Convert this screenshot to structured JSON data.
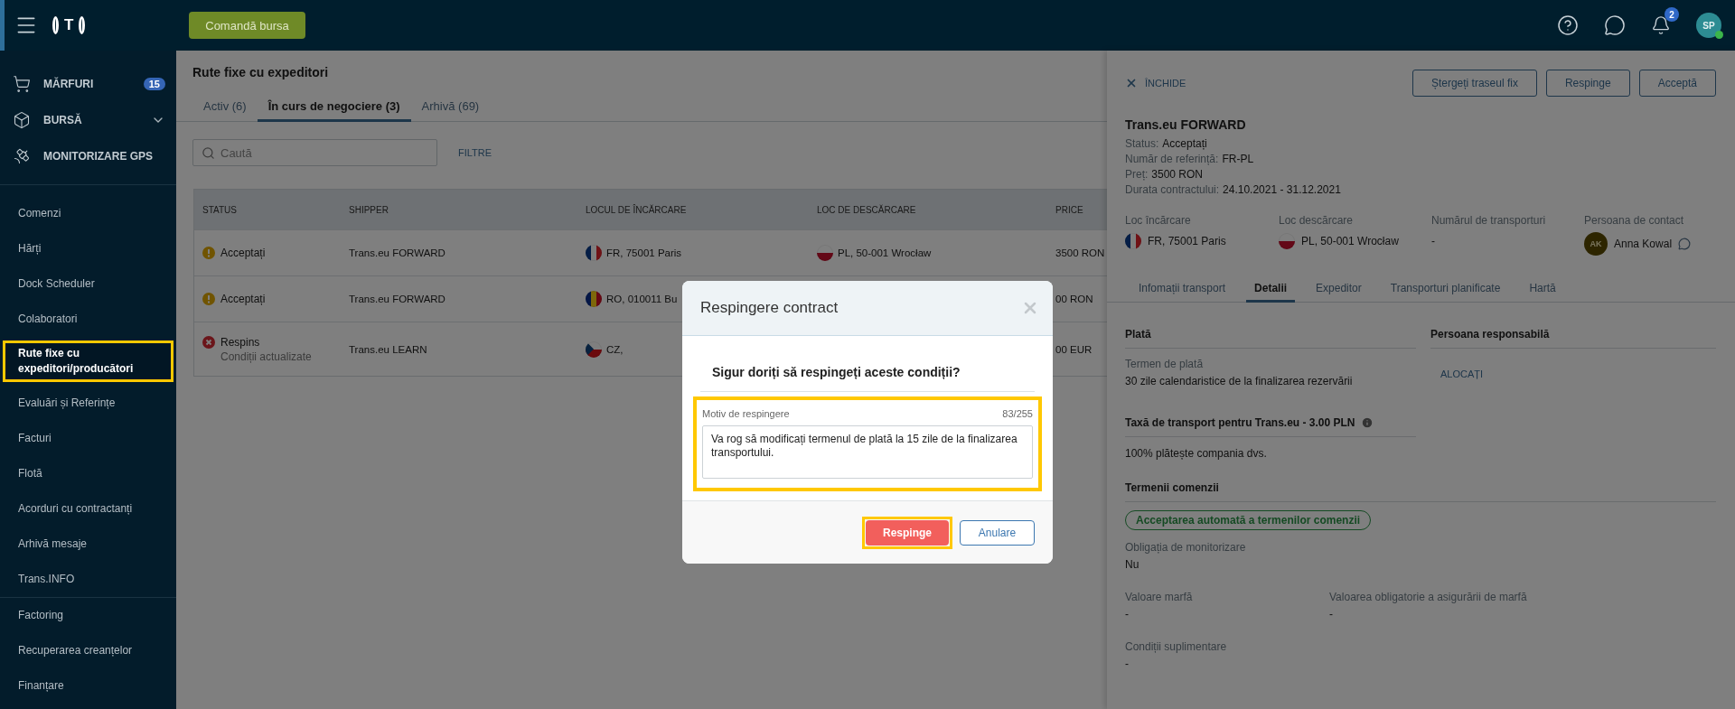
{
  "topbar": {
    "logo": "T",
    "order_button": "Comandă bursa",
    "notifications_badge": "2",
    "avatar": "SP",
    "online": true
  },
  "sidebar": {
    "main_items": [
      {
        "kind": "cart",
        "label": "MĂRFURI",
        "badge": "15"
      },
      {
        "kind": "box",
        "label": "BURSĂ",
        "expanded": false
      },
      {
        "kind": "satellite",
        "label": "MONITORIZARE GPS"
      }
    ],
    "sections": [
      [
        {
          "label": "Comenzi",
          "selected": false,
          "highlighted": false
        },
        {
          "label": "Hărți",
          "selected": false,
          "highlighted": false
        },
        {
          "label": "Dock Scheduler",
          "selected": false,
          "highlighted": false
        },
        {
          "label": "Colaboratori",
          "selected": false,
          "highlighted": false
        },
        {
          "label": "Rute fixe cu expeditori/producători",
          "selected": true,
          "highlighted": true
        },
        {
          "label": "Evaluări și Referințe",
          "selected": false,
          "highlighted": false
        },
        {
          "label": "Facturi",
          "selected": false,
          "highlighted": false
        },
        {
          "label": "Flotă",
          "selected": false,
          "highlighted": false
        },
        {
          "label": "Acorduri cu contractanți",
          "selected": false,
          "highlighted": false
        },
        {
          "label": "Arhivă mesaje",
          "selected": false,
          "highlighted": false
        },
        {
          "label": "Trans.INFO",
          "selected": false,
          "highlighted": false
        }
      ],
      [
        {
          "label": "Factoring",
          "selected": false,
          "highlighted": false
        },
        {
          "label": "Recuperarea creanțelor",
          "selected": false,
          "highlighted": false
        },
        {
          "label": "Finanțare",
          "selected": false,
          "highlighted": false
        }
      ]
    ]
  },
  "page": {
    "title": "Rute fixe cu expeditori",
    "tabs": [
      {
        "label": "Activ (6)",
        "selected": false
      },
      {
        "label": "În curs de negociere (3)",
        "selected": true
      },
      {
        "label": "Arhivă (69)",
        "selected": false
      }
    ],
    "search": {
      "placeholder": "Caută"
    },
    "filters": "FILTRE",
    "table": {
      "columns": [
        "STATUS",
        "SHIPPER",
        "LOCUL DE ÎNCĂRCARE",
        "LOC DE DESCĂRCARE",
        "PRICE"
      ],
      "rows": [
        {
          "status": {
            "kind": "warning",
            "label": "Acceptați"
          },
          "shipper": "Trans.eu FORWARD",
          "loading": {
            "flag": {
              "kind": "fr"
            },
            "text": "FR, 75001 Paris"
          },
          "unloading": {
            "flag": {
              "kind": "pl"
            },
            "text": "PL, 50-001 Wrocław"
          },
          "price": "3500 RON"
        },
        {
          "status": {
            "kind": "warning",
            "label": "Acceptați"
          },
          "shipper": "Trans.eu FORWARD",
          "loading": {
            "flag": {
              "kind": "ro"
            },
            "text": "RO, 010011 Bu"
          },
          "price": "00 RON"
        },
        {
          "status": {
            "kind": "error",
            "label": "Respins",
            "note": "Condiții actualizate"
          },
          "shipper": "Trans.eu LEARN",
          "loading": {
            "flag": {
              "kind": "cz"
            },
            "text": "CZ,"
          },
          "price": "00 EUR"
        }
      ]
    }
  },
  "panel": {
    "close": "ÎNCHIDE",
    "actions": [
      "Ștergeți traseul fix",
      "Respinge",
      "Acceptă"
    ],
    "title": "Trans.eu FORWARD",
    "facts": [
      {
        "label": "Status:",
        "value": "Acceptați"
      },
      {
        "label": "Număr de referință:",
        "value": "FR-PL"
      },
      {
        "label": "Preț:",
        "value": "3500 RON"
      },
      {
        "label": "Durata contractului:",
        "value": "24.10.2021 - 31.12.2021"
      }
    ],
    "route": [
      {
        "kind": "place",
        "label": "Loc încărcare",
        "flag": {
          "kind": "fr"
        },
        "value": "FR, 75001 Paris"
      },
      {
        "kind": "place",
        "label": "Loc descărcare",
        "flag": {
          "kind": "pl"
        },
        "value": "PL, 50-001 Wrocław"
      },
      {
        "kind": "text",
        "label": "Numărul de transporturi",
        "value": "-"
      },
      {
        "kind": "contact",
        "label": "Persoana de contact",
        "initials": "AK",
        "value": "Anna Kowal"
      }
    ],
    "tabs": [
      {
        "label": "Infomații transport",
        "selected": false
      },
      {
        "label": "Detalii",
        "selected": true
      },
      {
        "label": "Expeditor",
        "selected": false
      },
      {
        "label": "Transporturi planificate",
        "selected": false
      },
      {
        "label": "Hartă",
        "selected": false
      }
    ],
    "payment": {
      "heading": "Plată",
      "term_label": "Termen de plată",
      "term_value": "30 zile calendaristice de la finalizarea rezervării"
    },
    "responsible": {
      "heading": "Persoana responsabilă",
      "action": "ALOCAȚI"
    },
    "fee": {
      "heading": "Taxă de transport pentru Trans.eu - 3.00 PLN",
      "value": "100% plătește compania dvs."
    },
    "terms": {
      "heading": "Termenii comenzii",
      "badge": "Acceptarea automată a termenilor comenzii",
      "fields": [
        [
          {
            "label": "Obligația de monitorizare",
            "value": "Nu"
          }
        ],
        [
          {
            "label": "Valoare marfă",
            "value": "-"
          },
          {
            "label": "Valoarea obligatorie a asigurării de marfă",
            "value": "-"
          }
        ],
        [
          {
            "label": "Condiții suplimentare",
            "value": "-"
          }
        ]
      ]
    }
  },
  "modal": {
    "title": "Respingere contract",
    "question": "Sigur doriți să respingeți aceste condiții?",
    "reason": {
      "label": "Motiv de respingere",
      "counter": "83/255",
      "value": "Va rog să modificați termenul de plată la 15 zile de la finalizarea transportului.",
      "highlighted": true
    },
    "buttons": [
      {
        "kind": "danger",
        "label": "Respinge",
        "highlighted": true
      },
      {
        "kind": "outline",
        "label": "Anulare",
        "highlighted": false
      }
    ]
  }
}
